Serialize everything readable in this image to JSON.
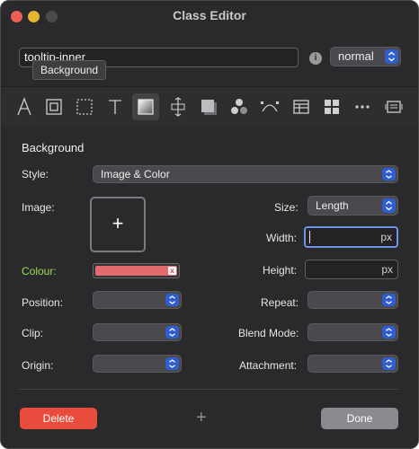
{
  "window": {
    "title": "Class Editor"
  },
  "header": {
    "class_name": "tooltip-inner",
    "tooltip": "Background",
    "state_value": "normal"
  },
  "toolbar": {
    "icons": [
      "typography-icon",
      "box-icon",
      "border-icon",
      "text-icon",
      "background-icon",
      "size-icon",
      "shadow-icon",
      "effects-icon",
      "transform-icon",
      "table-icon",
      "grid-icon",
      "more-icon",
      "custom-css-icon"
    ],
    "active": "background-icon"
  },
  "background": {
    "section_title": "Background",
    "style_label": "Style:",
    "style_value": "Image & Color",
    "image_label": "Image:",
    "image_add": "+",
    "size_label": "Size:",
    "size_value": "Length",
    "width_label": "Width:",
    "width_unit": "px",
    "colour_label": "Colour:",
    "colour_value": "#e26a6e",
    "colour_clear": "x",
    "height_label": "Height:",
    "height_unit": "px",
    "position_label": "Position:",
    "repeat_label": "Repeat:",
    "clip_label": "Clip:",
    "blend_label": "Blend Mode:",
    "origin_label": "Origin:",
    "attachment_label": "Attachment:"
  },
  "footer": {
    "delete_label": "Delete",
    "add_label": "+",
    "done_label": "Done"
  },
  "colors": {
    "accent_blue": "#2f5fcf",
    "delete_red": "#e94b3c",
    "colour_label_green": "#9ade4f"
  }
}
